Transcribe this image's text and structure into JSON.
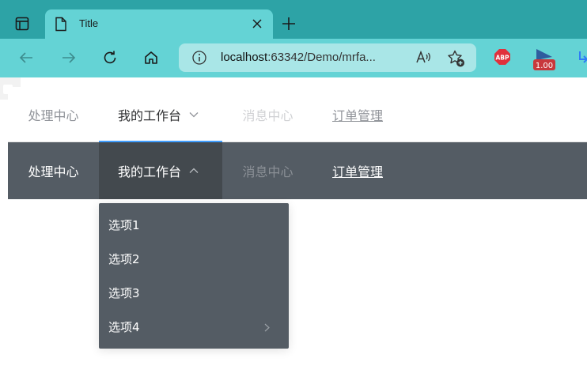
{
  "browser": {
    "tab": {
      "title": "Title"
    },
    "address": {
      "host": "localhost",
      "path": ":63342/Demo/mrfa..."
    },
    "extensions": {
      "abp_label": "ABP",
      "rating_label": "1.00"
    }
  },
  "menu_light": {
    "items": [
      {
        "label": "处理中心"
      },
      {
        "label": "我的工作台"
      },
      {
        "label": "消息中心"
      },
      {
        "label": "订单管理"
      }
    ]
  },
  "menu_dark": {
    "items": [
      {
        "label": "处理中心"
      },
      {
        "label": "我的工作台"
      },
      {
        "label": "消息中心"
      },
      {
        "label": "订单管理"
      }
    ],
    "submenu": [
      {
        "label": "选项1"
      },
      {
        "label": "选项2"
      },
      {
        "label": "选项3"
      },
      {
        "label": "选项4"
      }
    ]
  },
  "colors": {
    "tab_strip": "#2da3a6",
    "toolbar": "#64d3d5",
    "active_underline": "#409eff",
    "dark_menu_bg": "#545c64",
    "dark_menu_active": "#43494e"
  }
}
